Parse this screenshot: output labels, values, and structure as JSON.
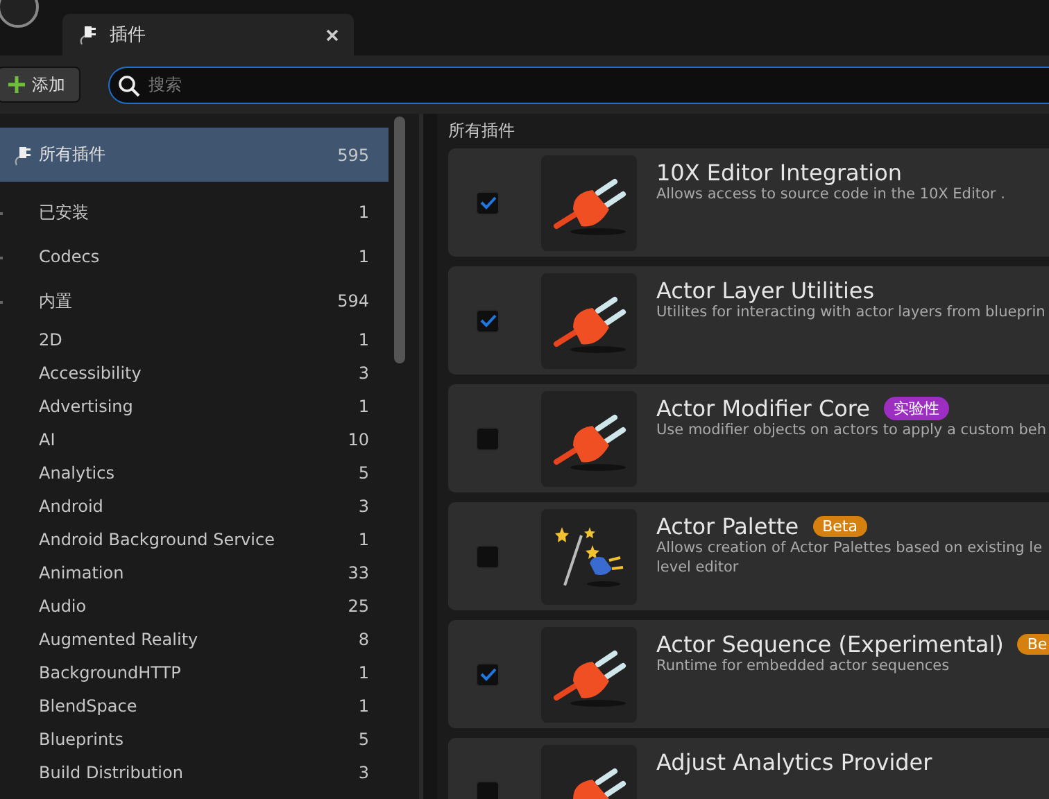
{
  "tab": {
    "title": "插件"
  },
  "toolbar": {
    "add_label": "添加",
    "search": {
      "placeholder": "搜索"
    }
  },
  "sidebar": {
    "items": [
      {
        "kind": "group",
        "label": "所有插件",
        "count": "595",
        "selected": true
      },
      {
        "kind": "group",
        "label": "已安装",
        "count": "1",
        "selected": false
      },
      {
        "kind": "group",
        "label": "Codecs",
        "count": "1",
        "selected": false
      },
      {
        "kind": "group",
        "label": "内置",
        "count": "594",
        "selected": false
      },
      {
        "kind": "item",
        "label": "2D",
        "count": "1",
        "selected": false
      },
      {
        "kind": "item",
        "label": "Accessibility",
        "count": "3",
        "selected": false
      },
      {
        "kind": "item",
        "label": "Advertising",
        "count": "1",
        "selected": false
      },
      {
        "kind": "item",
        "label": "AI",
        "count": "10",
        "selected": false
      },
      {
        "kind": "item",
        "label": "Analytics",
        "count": "5",
        "selected": false
      },
      {
        "kind": "item",
        "label": "Android",
        "count": "3",
        "selected": false
      },
      {
        "kind": "item",
        "label": "Android Background Service",
        "count": "1",
        "selected": false
      },
      {
        "kind": "item",
        "label": "Animation",
        "count": "33",
        "selected": false
      },
      {
        "kind": "item",
        "label": "Audio",
        "count": "25",
        "selected": false
      },
      {
        "kind": "item",
        "label": "Augmented Reality",
        "count": "8",
        "selected": false
      },
      {
        "kind": "item",
        "label": "BackgroundHTTP",
        "count": "1",
        "selected": false
      },
      {
        "kind": "item",
        "label": "BlendSpace",
        "count": "1",
        "selected": false
      },
      {
        "kind": "item",
        "label": "Blueprints",
        "count": "5",
        "selected": false
      },
      {
        "kind": "item",
        "label": "Build Distribution",
        "count": "3",
        "selected": false
      }
    ]
  },
  "plugins": {
    "heading": "所有插件",
    "items": [
      {
        "kind": "plug",
        "name": "10X Editor Integration",
        "description": "Allows access to source code in the 10X Editor .",
        "checked": true
      },
      {
        "kind": "plug",
        "name": "Actor Layer Utilities",
        "description": "Utilites for interacting with actor layers from blueprin",
        "checked": true
      },
      {
        "kind": "plug",
        "name": "Actor Modifier Core",
        "badge": "实验性",
        "color": "#9c2fc2",
        "description": "Use modifier objects on actors to apply a custom beh",
        "checked": false
      },
      {
        "kind": "wand",
        "name": "Actor Palette",
        "badge": "Beta",
        "color": "#d6800f",
        "description": "Allows creation of Actor Palettes based on existing le\nlevel editor",
        "checked": false
      },
      {
        "kind": "plug",
        "name": "Actor Sequence (Experimental)",
        "badge": "Be",
        "color": "#d6800f",
        "description": "Runtime for embedded actor sequences",
        "checked": true
      },
      {
        "kind": "plug",
        "name": "Adjust Analytics Provider",
        "checked": false
      }
    ]
  }
}
